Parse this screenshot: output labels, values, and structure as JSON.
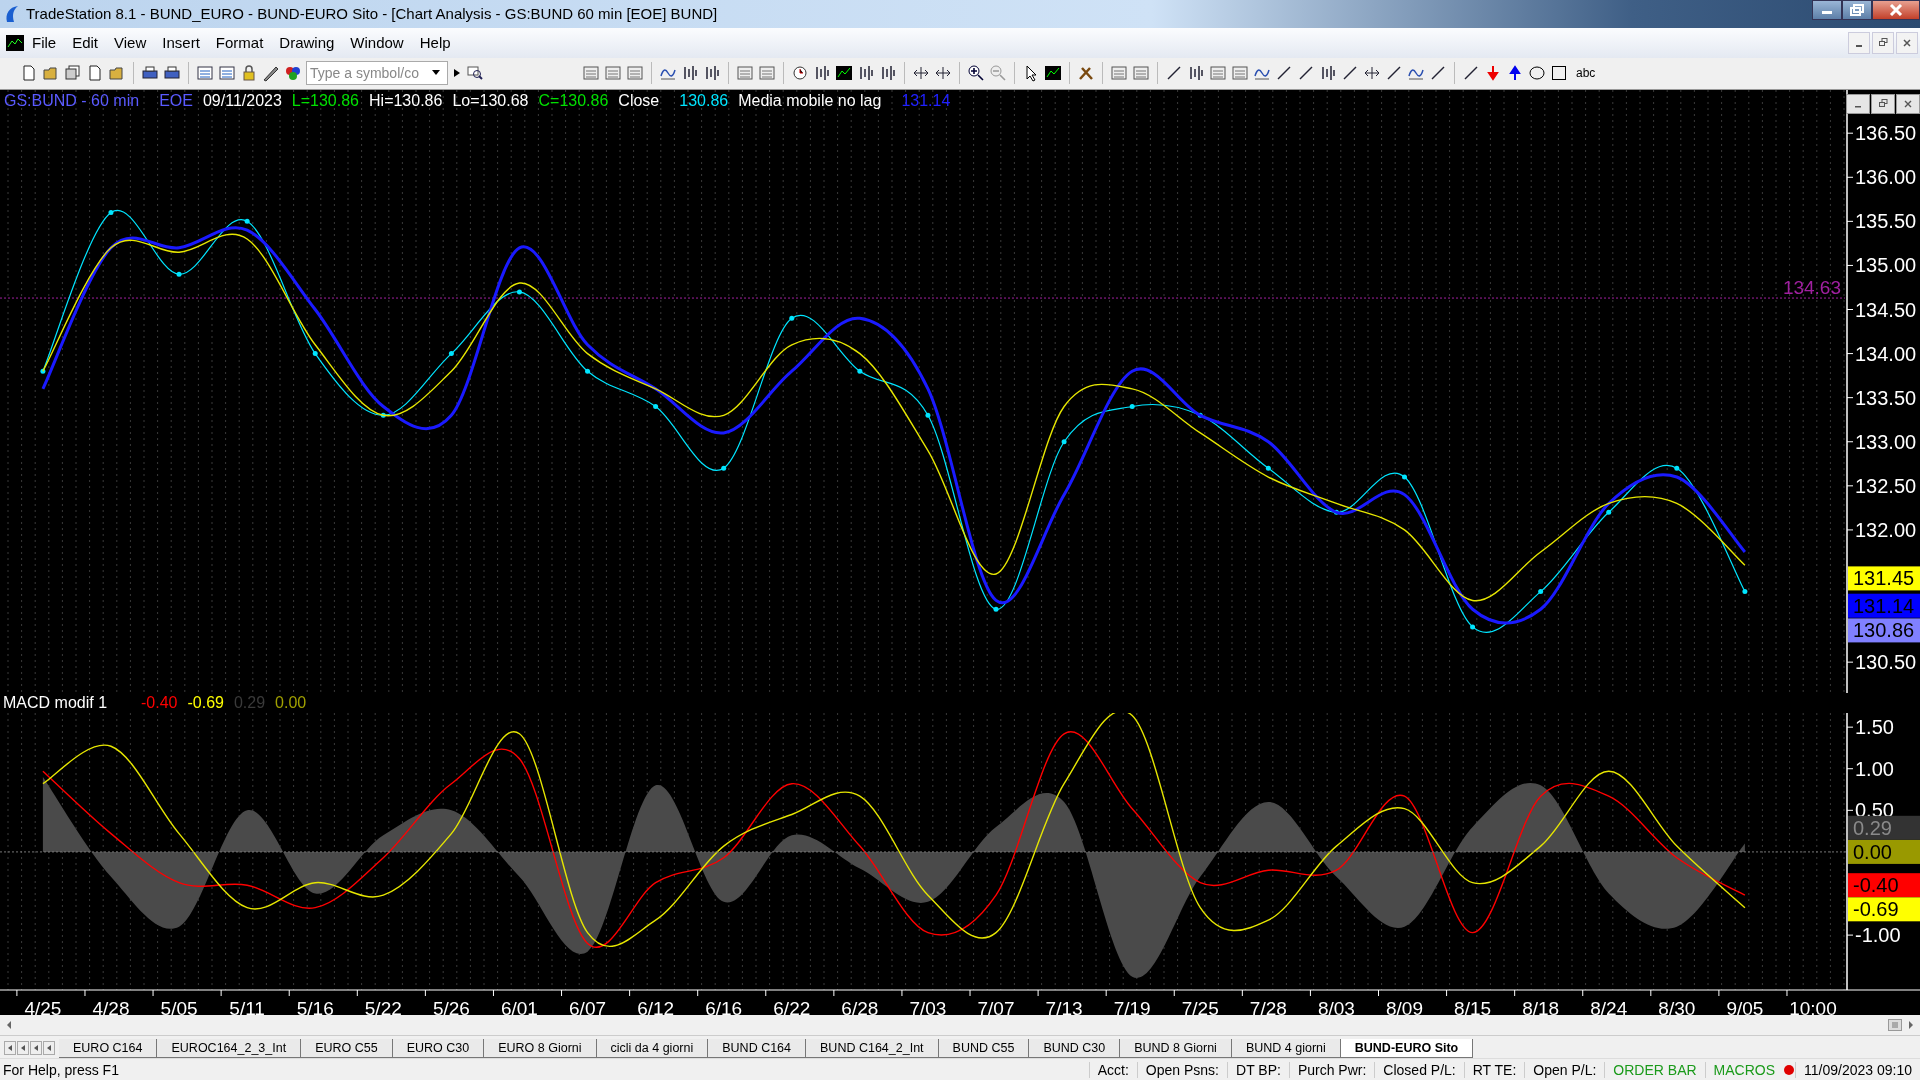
{
  "window": {
    "title": "TradeStation 8.1 - BUND_EURO - BUND-EURO Sito - [Chart Analysis - GS:BUND  60 min  [EOE] BUND]"
  },
  "menu": [
    "File",
    "Edit",
    "View",
    "Insert",
    "Format",
    "Drawing",
    "Window",
    "Help"
  ],
  "symbol_field": {
    "placeholder": "Type a symbol/co"
  },
  "toolbar_text": "abc",
  "price_pane": {
    "legend": [
      {
        "text": "GS:BUND - 60 min",
        "color": "#5a5aff"
      },
      {
        "text": "EOE",
        "color": "#5a5aff"
      },
      {
        "text": "09/11/2023",
        "color": "#ffffff"
      },
      {
        "text": "L=130.86",
        "color": "#00e000"
      },
      {
        "text": "Hi=130.86",
        "color": "#ffffff"
      },
      {
        "text": "Lo=130.68",
        "color": "#ffffff"
      },
      {
        "text": "C=130.86",
        "color": "#00e000"
      },
      {
        "text": "Close",
        "color": "#ffffff"
      },
      {
        "text": "130.86",
        "color": "#00e5ff"
      },
      {
        "text": "Media mobile no lag",
        "color": "#ffffff"
      },
      {
        "text": "131.14",
        "color": "#2020ff"
      }
    ],
    "tags": [
      {
        "text": "131.45",
        "color": "#ffff00"
      },
      {
        "text": "131.14",
        "color": "#0000ff"
      },
      {
        "text": "130.86",
        "color": "#8080ff"
      }
    ],
    "chart_data": {
      "type": "line",
      "grid": true,
      "ylim": [
        130.15,
        136.99
      ],
      "ref_lines": [
        {
          "axis": "y",
          "value": 134.63,
          "label": "134.63",
          "color": "#a020a0"
        }
      ],
      "yticks": [
        {
          "value": 136.5,
          "label": "136.50"
        },
        {
          "value": 136,
          "label": "136.00"
        },
        {
          "value": 135.5,
          "label": "135.50"
        },
        {
          "value": 135,
          "label": "135.00"
        },
        {
          "value": 134.5,
          "label": "134.50"
        },
        {
          "value": 134,
          "label": "134.00"
        },
        {
          "value": 133.5,
          "label": "133.50"
        },
        {
          "value": 133,
          "label": "133.00"
        },
        {
          "value": 132.5,
          "label": "132.50"
        },
        {
          "value": 132,
          "label": "132.00"
        },
        {
          "value": 130.5,
          "label": "130.50"
        }
      ],
      "series": [
        {
          "color": "#00e5ff",
          "values": [
            133.8,
            135.6,
            134.9,
            135.5,
            134.0,
            133.3,
            134.0,
            134.7,
            133.8,
            133.4,
            132.7,
            134.4,
            133.8,
            133.3,
            131.1,
            133.0,
            133.4,
            133.3,
            132.7,
            132.2,
            132.6,
            130.9,
            131.3,
            132.2,
            132.7,
            131.3,
            null
          ]
        },
        {
          "color": "#1a1aff",
          "values": [
            133.6,
            135.2,
            135.2,
            135.4,
            134.5,
            133.4,
            133.3,
            135.2,
            134.1,
            133.6,
            133.1,
            133.8,
            134.4,
            133.6,
            131.2,
            132.4,
            133.8,
            133.3,
            133.0,
            132.2,
            132.4,
            131.1,
            131.1,
            132.3,
            132.6,
            131.75,
            null
          ]
        },
        {
          "color": "#e6e600",
          "values": [
            133.8,
            135.2,
            135.15,
            135.3,
            134.1,
            133.3,
            133.8,
            134.8,
            134.0,
            133.6,
            133.3,
            134.1,
            134.0,
            132.9,
            131.5,
            133.4,
            133.6,
            133.1,
            132.6,
            132.3,
            132.0,
            131.2,
            131.75,
            132.3,
            132.3,
            131.6,
            null
          ]
        }
      ]
    }
  },
  "macd_pane": {
    "legend": [
      {
        "text": "MACD modif 1",
        "color": "#ffffff"
      },
      {
        "text": "-0.40",
        "color": "#ff0000"
      },
      {
        "text": "-0.69",
        "color": "#ffff00"
      },
      {
        "text": "0.29",
        "color": "#3a3a3a"
      },
      {
        "text": "0.00",
        "color": "#a0a000"
      }
    ],
    "tags": [
      {
        "text": "0.29",
        "color": "#333333"
      },
      {
        "text": "0.00",
        "color": "#999900"
      },
      {
        "text": "-0.40",
        "color": "#ff0000"
      },
      {
        "text": "-0.69",
        "color": "#ffff00"
      }
    ],
    "chart_data": {
      "type": "line",
      "grid": true,
      "ylim": [
        -1.66,
        1.67
      ],
      "ref_lines": [
        {
          "axis": "y",
          "value": 0,
          "color": "#777777"
        }
      ],
      "categories": [
        "4/25",
        "4/28",
        "5/05",
        "5/11",
        "5/16",
        "5/22",
        "5/26",
        "6/01",
        "6/07",
        "6/12",
        "6/16",
        "6/22",
        "6/28",
        "7/03",
        "7/07",
        "7/13",
        "7/19",
        "7/25",
        "7/28",
        "8/03",
        "8/09",
        "8/15",
        "8/18",
        "8/24",
        "8/30",
        "9/05",
        "10:00"
      ],
      "yticks": [
        {
          "value": 1.5,
          "label": "1.50"
        },
        {
          "value": 1,
          "label": "1.00"
        },
        {
          "value": 0.5,
          "label": "0.50"
        },
        {
          "value": -1,
          "label": "-1.00"
        }
      ],
      "series": [
        {
          "color": "#4a4a4a",
          "type": "area",
          "values": [
            0.9,
            -0.3,
            -0.9,
            0.5,
            -0.5,
            0.2,
            0.5,
            -0.3,
            -1.2,
            0.8,
            -0.6,
            0.2,
            -0.2,
            -0.6,
            0.3,
            0.6,
            -1.5,
            -0.3,
            0.6,
            -0.3,
            -0.9,
            0.3,
            0.8,
            -0.5,
            -0.9,
            0.1,
            null
          ]
        },
        {
          "color": "#ff0000",
          "values": [
            0.97,
            0.22,
            -0.37,
            -0.4,
            -0.67,
            -0.07,
            0.82,
            1.12,
            -1.1,
            -0.37,
            -0.07,
            0.82,
            0.07,
            -0.97,
            -0.52,
            1.42,
            0.52,
            -0.37,
            -0.22,
            -0.22,
            0.67,
            -0.97,
            0.67,
            0.67,
            -0.07,
            -0.52,
            null
          ]
        },
        {
          "color": "#e6e600",
          "values": [
            0.82,
            1.27,
            0.22,
            -0.67,
            -0.37,
            -0.52,
            0.22,
            1.42,
            -0.97,
            -0.82,
            0.07,
            0.45,
            0.67,
            -0.52,
            -0.97,
            0.82,
            1.64,
            -0.67,
            -0.82,
            0.07,
            0.52,
            -0.37,
            0.07,
            0.97,
            0.07,
            -0.67,
            null
          ]
        }
      ]
    }
  },
  "tabs": [
    {
      "label": "EURO C164",
      "selected": false
    },
    {
      "label": "EUROC164_2_3_Int",
      "selected": false
    },
    {
      "label": "EURO C55",
      "selected": false
    },
    {
      "label": "EURO C30",
      "selected": false
    },
    {
      "label": "EURO 8 Giorni",
      "selected": false
    },
    {
      "label": "cicli da 4 giorni",
      "selected": false
    },
    {
      "label": "BUND C164",
      "selected": false
    },
    {
      "label": "BUND C164_2_Int",
      "selected": false
    },
    {
      "label": "BUND C55",
      "selected": false
    },
    {
      "label": "BUND  C30",
      "selected": false
    },
    {
      "label": "BUND 8 Giorni",
      "selected": false
    },
    {
      "label": "BUND 4 giorni",
      "selected": false
    },
    {
      "label": "BUND-EURO Sito",
      "selected": true
    }
  ],
  "status_bar": {
    "help": "For Help, press F1",
    "fields": [
      {
        "text": "Acct:",
        "color": "#000000"
      },
      {
        "text": "Open Psns:",
        "color": "#000000"
      },
      {
        "text": "DT BP:",
        "color": "#000000"
      },
      {
        "text": "Purch Pwr:",
        "color": "#000000"
      },
      {
        "text": "Closed P/L:",
        "color": "#000000"
      },
      {
        "text": "RT TE:",
        "color": "#000000"
      },
      {
        "text": "Open P/L:",
        "color": "#000000"
      },
      {
        "text": "ORDER BAR",
        "color": "#1a9a1a"
      },
      {
        "text": "MACROS",
        "color": "#1a9a1a"
      }
    ],
    "datetime": "11/09/2023 09:10"
  }
}
